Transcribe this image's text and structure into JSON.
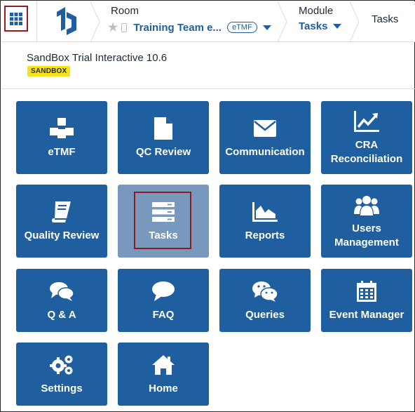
{
  "header": {
    "room_title": "Room",
    "room_name": "Training Team e...",
    "room_badge": "eTMF",
    "module_title": "Module",
    "module_name": "Tasks",
    "current_page": "Tasks"
  },
  "study": {
    "name": "SandBox Trial Interactive 10.6",
    "env_badge": "SANDBOX"
  },
  "tiles": [
    {
      "label": "eTMF",
      "icon": "cubes-icon"
    },
    {
      "label": "QC Review",
      "icon": "document-icon"
    },
    {
      "label": "Communication",
      "icon": "envelope-icon"
    },
    {
      "label": "CRA Reconciliation",
      "icon": "line-chart-icon"
    },
    {
      "label": "Quality Review",
      "icon": "book-icon"
    },
    {
      "label": "Tasks",
      "icon": "server-stack-icon"
    },
    {
      "label": "Reports",
      "icon": "area-chart-icon"
    },
    {
      "label": "Users Management",
      "icon": "users-icon"
    },
    {
      "label": "Q & A",
      "icon": "comments-icon"
    },
    {
      "label": "FAQ",
      "icon": "comment-icon"
    },
    {
      "label": "Queries",
      "icon": "wechat-icon"
    },
    {
      "label": "Event Manager",
      "icon": "calendar-icon"
    },
    {
      "label": "Settings",
      "icon": "gears-icon"
    },
    {
      "label": "Home",
      "icon": "home-icon"
    }
  ],
  "colors": {
    "tile": "#1f5fa0",
    "tile_selected": "#7899bd",
    "highlight": "#8e1b1b",
    "badge": "#f7e11b"
  }
}
